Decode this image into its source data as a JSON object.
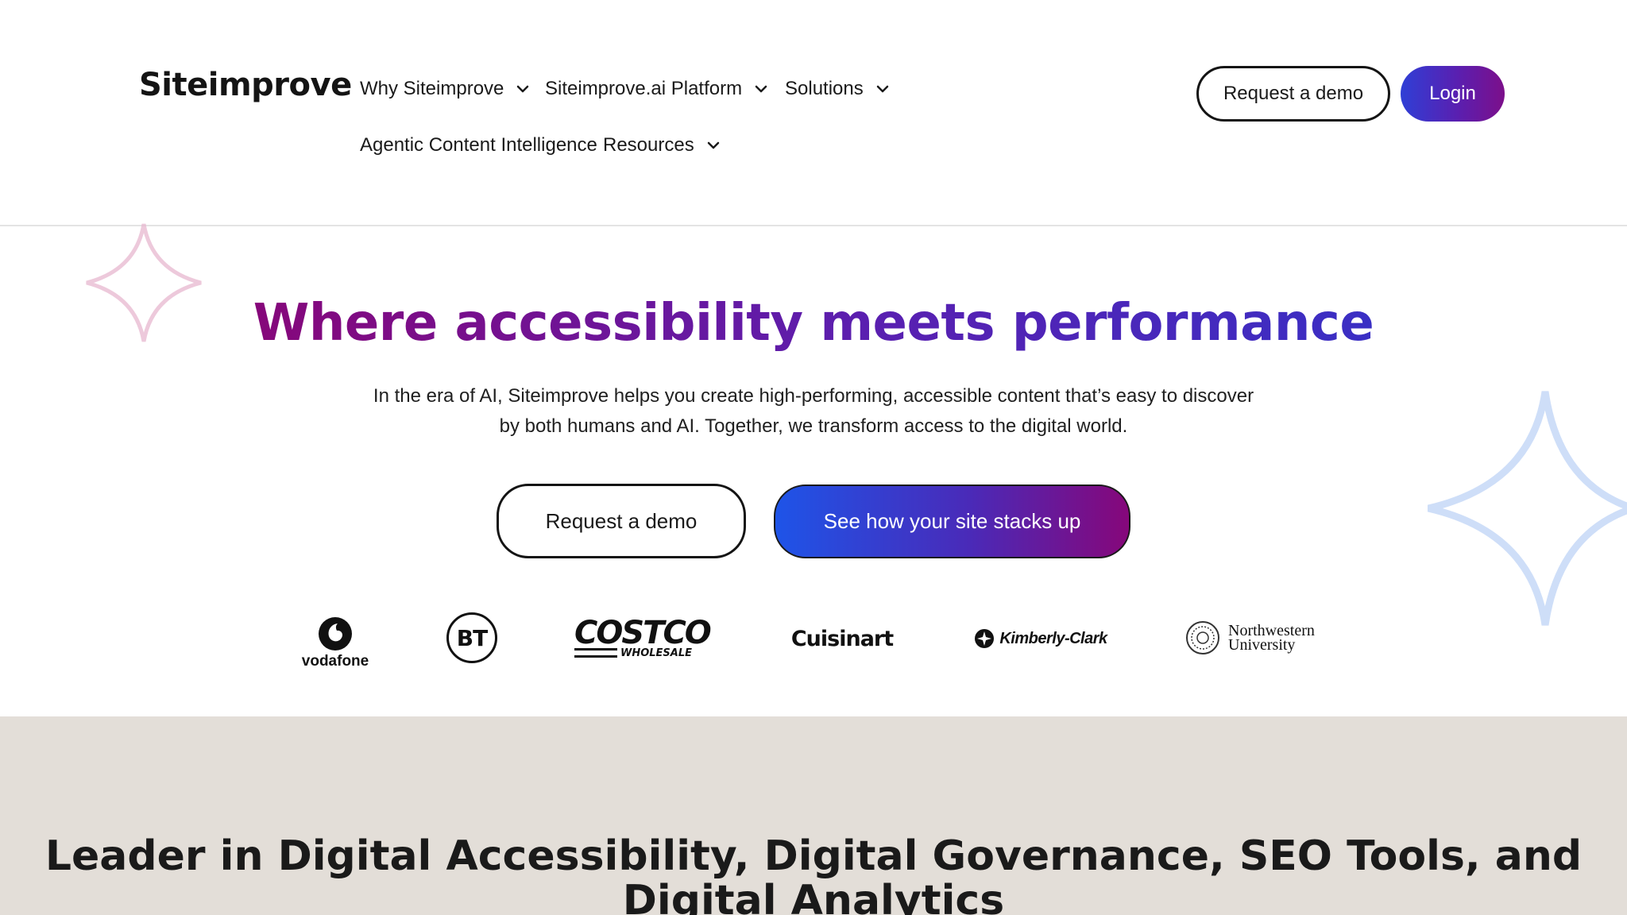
{
  "header": {
    "logo": "Siteimprove",
    "nav": [
      {
        "label": "Why Siteimprove",
        "has_dropdown": true
      },
      {
        "label": "Siteimprove.ai Platform",
        "has_dropdown": true
      },
      {
        "label": "Solutions",
        "has_dropdown": true
      },
      {
        "label": "Agentic Content Intelligence",
        "has_dropdown": false
      },
      {
        "label": "Resources",
        "has_dropdown": true
      }
    ],
    "request_demo_label": "Request a demo",
    "login_label": "Login"
  },
  "hero": {
    "title": "Where accessibility meets performance",
    "subtitle_line1": "In the era of AI, Siteimprove helps you create high-performing, accessible content that’s easy to discover",
    "subtitle_line2": "by both humans and AI. Together, we transform access to the digital world.",
    "request_demo_label": "Request a demo",
    "stack_up_label": "See how your site stacks up"
  },
  "customer_logos": {
    "vodafone": "vodafone",
    "bt": "BT",
    "costco_top": "COSTCO",
    "costco_bottom": "WHOLESALE",
    "cuisinart": "Cuisinart",
    "kimberly_clark": "Kimberly-Clark",
    "northwestern_line1": "Northwestern",
    "northwestern_line2": "University"
  },
  "leader_section": {
    "title_line1": "Leader in Digital Accessibility, Digital Governance, SEO Tools, and",
    "title_line2": "Digital Analytics"
  },
  "colors": {
    "brand_purple": "#86077a",
    "brand_blue": "#1e54e8",
    "section_bg": "#e3ded8"
  }
}
